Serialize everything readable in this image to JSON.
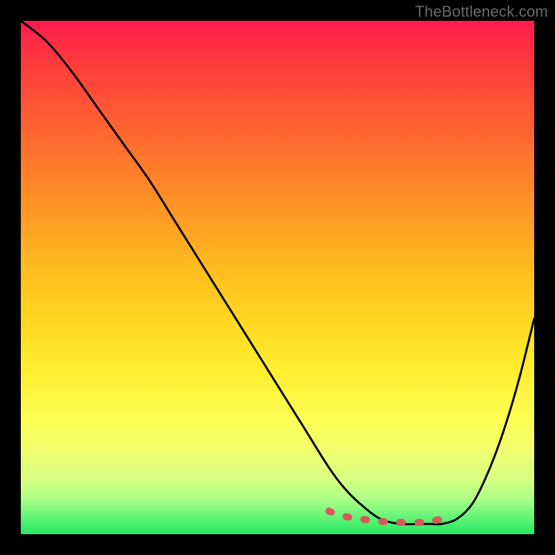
{
  "watermark": "TheBottleneck.com",
  "chart_data": {
    "type": "line",
    "title": "",
    "xlabel": "",
    "ylabel": "",
    "xlim": [
      0,
      100
    ],
    "ylim": [
      0,
      100
    ],
    "gradient_stops": [
      {
        "pos": 0,
        "color": "#ff1a4d"
      },
      {
        "pos": 18,
        "color": "#ff5a33"
      },
      {
        "pos": 38,
        "color": "#ff9a24"
      },
      {
        "pos": 58,
        "color": "#ffd61f"
      },
      {
        "pos": 78,
        "color": "#fcff55"
      },
      {
        "pos": 93,
        "color": "#b0ff88"
      },
      {
        "pos": 100,
        "color": "#27e862"
      }
    ],
    "series": [
      {
        "name": "black-curve",
        "x": [
          0,
          5,
          10,
          15,
          20,
          25,
          30,
          35,
          40,
          45,
          50,
          55,
          60,
          63,
          66,
          70,
          74,
          78,
          80,
          82,
          85,
          88,
          91,
          94,
          97,
          100
        ],
        "y": [
          100,
          96,
          90,
          83,
          76,
          69,
          61,
          53,
          45,
          37,
          29,
          21,
          13,
          9,
          6,
          3,
          2,
          2,
          2,
          2,
          3,
          6,
          12,
          20,
          30,
          42
        ]
      },
      {
        "name": "red-dash-highlight",
        "x": [
          60,
          63,
          66,
          70,
          74,
          78,
          80,
          82
        ],
        "y": [
          4.5,
          3.5,
          3,
          2.5,
          2.3,
          2.3,
          2.5,
          3
        ]
      }
    ]
  }
}
